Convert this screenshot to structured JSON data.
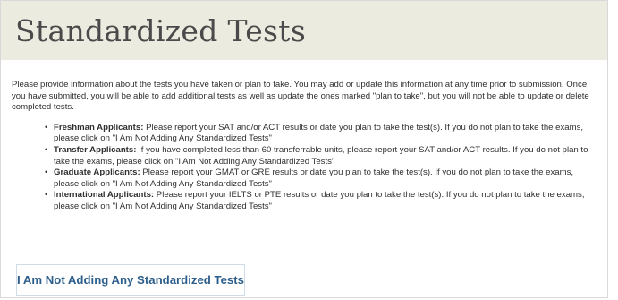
{
  "header": {
    "title": "Standardized Tests"
  },
  "intro": "Please provide information about the tests you have taken or plan to take. You may add or update this information at any time prior to submission. Once you have submitted, you will be able to add additional tests as well as update the ones marked \"plan to take\", but you will not be able to update or delete completed tests.",
  "bullets": [
    {
      "label": "Freshman Applicants:",
      "text": " Please report your SAT and/or ACT results or date you plan to take the test(s). If you do not plan to take the exams, please click on \"I Am Not Adding Any Standardized Tests\""
    },
    {
      "label": "Transfer Applicants:",
      "text": " If you have completed less than 60 transferrable units, please report your SAT and/or ACT results. If you do not plan to take the exams, please click on \"I Am Not Adding Any Standardized Tests\""
    },
    {
      "label": "Graduate Applicants:",
      "text": " Please report your GMAT or GRE results or date you plan to take the test(s). If you do not plan to take the exams, please click on \"I Am Not Adding Any Standardized Tests\""
    },
    {
      "label": "International Applicants:",
      "text": " Please report your IELTS or PTE results or date you plan to take the test(s). If you do not plan to take the exams, please click on \"I Am Not Adding Any Standardized Tests\""
    }
  ],
  "bullet_char": "•",
  "button": {
    "label": "I Am Not Adding Any Standardized Tests"
  },
  "colors": {
    "header_bg": "#ecebdf",
    "button_text": "#2c5e8c",
    "button_border": "#cfdbe6"
  }
}
